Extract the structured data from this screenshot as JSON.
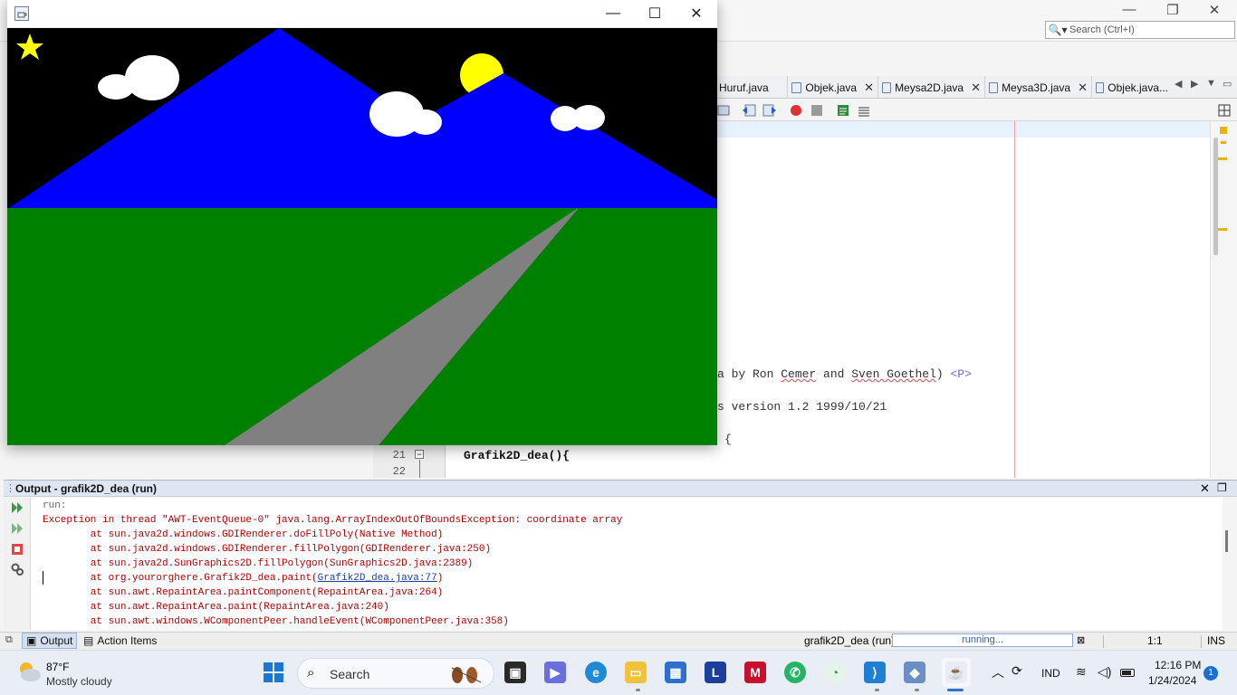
{
  "ide": {
    "search_placeholder": "Search (Ctrl+I)",
    "tabs": [
      {
        "label": "Huruf.java"
      },
      {
        "label": "Objek.java"
      },
      {
        "label": "Meysa2D.java"
      },
      {
        "label": "Meysa3D.java"
      },
      {
        "label": "Objek.java..."
      }
    ],
    "code": {
      "line_a_pre": "a by Ron ",
      "line_a_name1": "Cemer",
      "line_a_mid": " and ",
      "line_a_name2": "Sven Goethel",
      "line_a_post": ") ",
      "line_a_tag": "<P>",
      "line_b": "s version 1.2 1999/10/21",
      "line_c": "{",
      "line21_num": "21",
      "line21_text": "Grafik2D_dea(){",
      "line22_num": "22"
    }
  },
  "app_window": {
    "title": "",
    "minimize": "—",
    "maximize": "☐",
    "close": "✕",
    "scene_colors": {
      "sky": "#000000",
      "mountain": "#0000ff",
      "grass": "#008000",
      "road": "#808080",
      "sun": "#ffff00",
      "star": "#ffff00",
      "cloud": "#ffffff"
    }
  },
  "output": {
    "title": "Output - grafik2D_dea (run)",
    "lines": [
      "run:",
      "Exception in thread \"AWT-EventQueue-0\" java.lang.ArrayIndexOutOfBoundsException: coordinate array",
      "        at sun.java2d.windows.GDIRenderer.doFillPoly(Native Method)",
      "        at sun.java2d.windows.GDIRenderer.fillPolygon(GDIRenderer.java:250)",
      "        at sun.java2d.SunGraphics2D.fillPolygon(SunGraphics2D.java:2389)",
      "        at org.yourorghere.Grafik2D_dea.paint(",
      "        at sun.awt.RepaintArea.paintComponent(RepaintArea.java:264)",
      "        at sun.awt.RepaintArea.paint(RepaintArea.java:240)",
      "        at sun.awt.windows.WComponentPeer.handleEvent(WComponentPeer.java:358)"
    ],
    "link_text": "Grafik2D_dea.java:77",
    "link_suffix": ")"
  },
  "statusbar": {
    "output_tab": "Output",
    "action_items_tab": "Action Items",
    "project": "grafik2D_dea (run)",
    "progress_text": "running...",
    "position": "1:1",
    "mode": "INS"
  },
  "taskbar": {
    "weather_temp": "87°F",
    "weather_desc": "Mostly cloudy",
    "search_label": "Search",
    "language": "IND",
    "time": "12:16 PM",
    "date": "1/24/2024",
    "notification_count": "1"
  }
}
